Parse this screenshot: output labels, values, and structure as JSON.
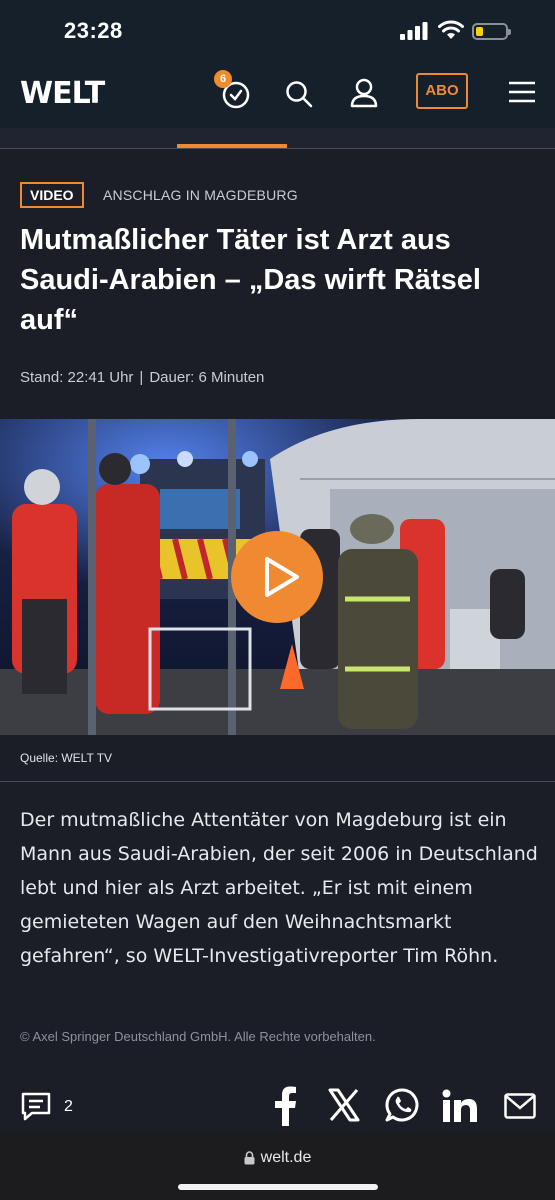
{
  "status_bar": {
    "time": "23:28"
  },
  "header": {
    "logo": "WELT",
    "news_count": "6",
    "abo_label": "ABO"
  },
  "article": {
    "badge": "VIDEO",
    "kicker": "ANSCHLAG IN MAGDEBURG",
    "headline": "Mutmaßlicher Täter ist Arzt aus Saudi-Arabien – „Das wirft Rätsel auf“",
    "stand": "Stand: 22:41 Uhr",
    "separator": "|",
    "duration": "Dauer: 6 Minuten",
    "source": "Quelle: WELT TV",
    "body": "Der mutmaßliche Attentäter von Magdeburg ist ein Mann aus Saudi-Arabien, der seit 2006 in Deutschland lebt und hier als Arzt arbeitet. „Er ist mit einem gemieteten Wagen auf den Weihnachtsmarkt gefahren“, so WELT-Investigativreporter Tim Röhn.",
    "copyright": "© Axel Springer Deutschland GmbH. Alle Rechte vorbehalten."
  },
  "footer": {
    "comment_count": "2"
  },
  "browser": {
    "url": "welt.de"
  },
  "colors": {
    "accent": "#f08a32",
    "background": "#1b1e27",
    "header": "#15202b"
  }
}
